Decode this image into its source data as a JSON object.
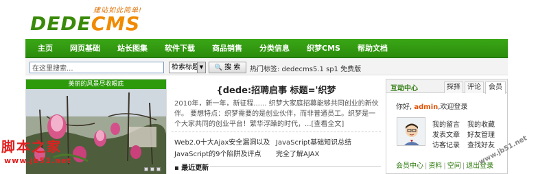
{
  "logo": {
    "text_a": "DEDE",
    "text_b": "CMS",
    "slogan": "建站如此简单!"
  },
  "nav": {
    "items": [
      "主页",
      "网页基础",
      "站长图集",
      "软件下载",
      "商品销售",
      "分类信息",
      "织梦CMS",
      "帮助文档"
    ]
  },
  "search": {
    "placeholder": "在这里搜索...",
    "select_value": "检索标题",
    "button_label": "搜 索",
    "hot_label": "热门标签: dedecms5.1 sp1 免费版"
  },
  "slideshow": {
    "title": "美丽的风景尽收眼底"
  },
  "article": {
    "headline": "{dede:招聘启事 标题='织梦",
    "summary": "2010年，新一年，新征程...... 织梦大家庭招募能够共同创业的新伙伴。 要想特点：织梦需要的是创业伙伴，而非普通员工。织梦是一个大家共同的创业平台！繁华浮躁的时代，...[查看全文]"
  },
  "links": [
    "Web2.0十大Ajax安全漏洞以及",
    "JavaScript基础知识总结",
    "JavaScript的9个陷阱及评点",
    "完全了解AJAX"
  ],
  "recent": {
    "title": "最近更新"
  },
  "member": {
    "title": "互动中心",
    "tabs": [
      "探择",
      "评论",
      "会员"
    ],
    "greeting_prefix": "你好,",
    "username": "admin",
    "greeting_suffix": ",欢迎登录",
    "links": [
      "我的留言",
      "我的收藏",
      "发表文章",
      "好友管理",
      "访客记录",
      "查找好友"
    ],
    "bar": [
      "会员中心",
      "资料",
      "空间",
      "退出登录"
    ]
  },
  "watermark": {
    "text": "脚本之家",
    "url": "www.jb51.net",
    "url2": "www.jb51.net"
  }
}
